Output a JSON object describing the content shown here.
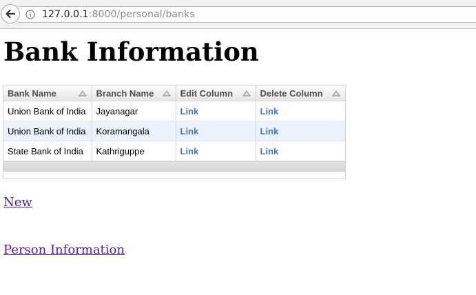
{
  "browser": {
    "url_host": "127.0.0.1",
    "url_rest": ":8000/personal/banks"
  },
  "page": {
    "title": "Bank Information"
  },
  "grid": {
    "columns": [
      "Bank Name",
      "Branch Name",
      "Edit Column",
      "Delete Column"
    ],
    "rows": [
      {
        "bank": "Union Bank of India",
        "branch": "Jayanagar",
        "edit": "Link",
        "delete": "Link"
      },
      {
        "bank": "Union Bank of India",
        "branch": "Koramangala",
        "edit": "Link",
        "delete": "Link"
      },
      {
        "bank": "State Bank of India",
        "branch": "Kathriguppe",
        "edit": "Link",
        "delete": "Link"
      }
    ]
  },
  "links": {
    "new": "New",
    "person_information": "Person Information"
  },
  "colors": {
    "link_visited": "#551a8b",
    "cell_link": "#4a77b4",
    "alt_row": "#eaf2fe"
  }
}
